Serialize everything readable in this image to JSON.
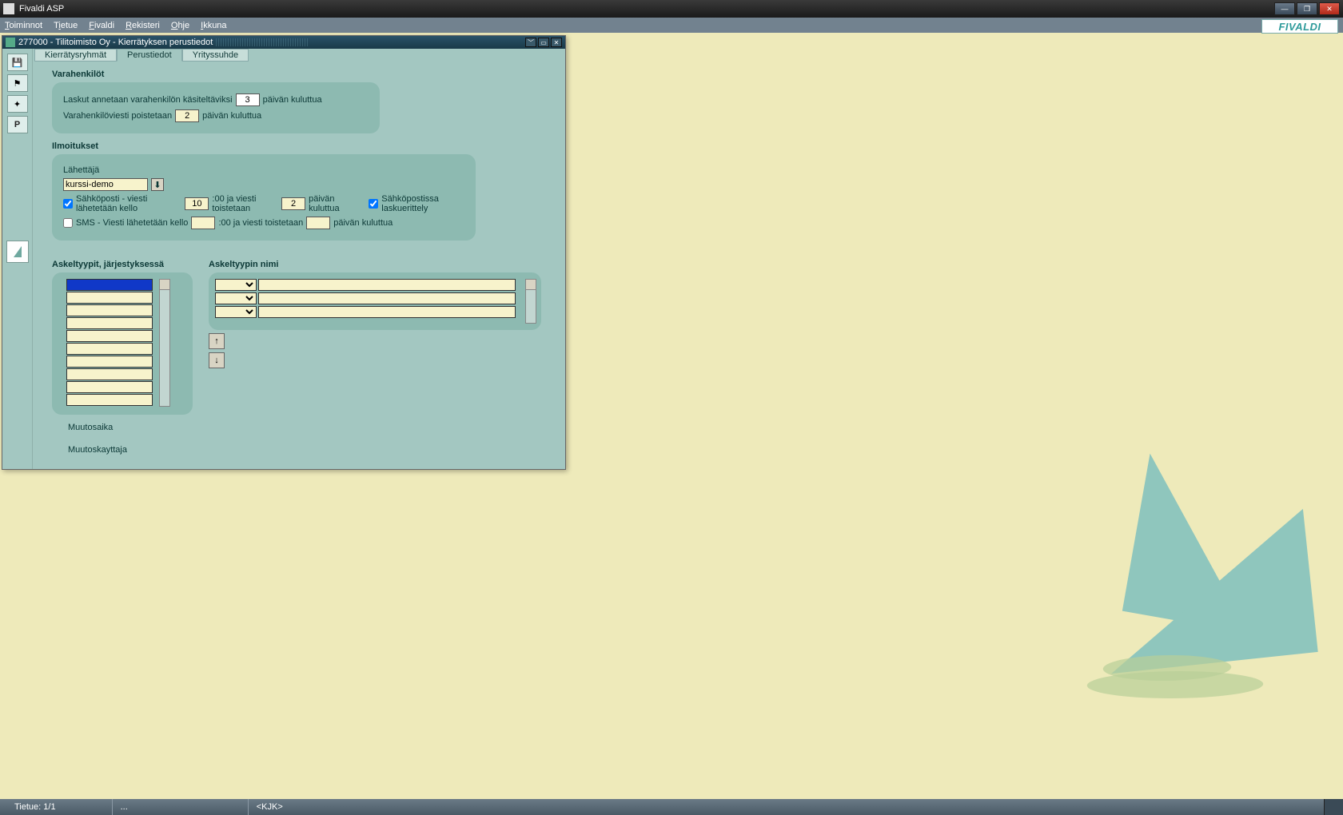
{
  "app": {
    "title": "Fivaldi ASP",
    "brand": "FIVALDI"
  },
  "menu": [
    "Toiminnot",
    "Tietue",
    "Fivaldi",
    "Rekisteri",
    "Ohje",
    "Ikkuna"
  ],
  "window": {
    "title": "277000 - Tilitoimisto Oy - Kierrätyksen perustiedot",
    "tabs": {
      "t1": "Kierrätysryhmät",
      "t2": "Perustiedot",
      "t3": "Yrityssuhde",
      "active": "t2"
    },
    "vara": {
      "heading": "Varahenkilöt",
      "l1a": "Laskut annetaan varahenkilön käsiteltäviksi",
      "v1": "3",
      "l1b": "päivän kuluttua",
      "l2a": "Varahenkilöviesti poistetaan",
      "v2": "2",
      "l2b": "päivän kuluttua"
    },
    "ilmo": {
      "heading": "Ilmoitukset",
      "sender_label": "Lähettäjä",
      "sender": "kurssi-demo",
      "email_label": "Sähköposti - viesti lähetetään kello",
      "email_checked": true,
      "email_h": "10",
      "after_h": ":00 ja viesti toistetaan",
      "email_d": "2",
      "after_d": "päivän kuluttua",
      "erit_label": "Sähköpostissa laskuerittely",
      "erit_checked": true,
      "sms_label": "SMS - Viesti lähetetään kello",
      "sms_checked": false,
      "sms_h": "",
      "sms_d": ""
    },
    "askel": {
      "h1": "Askeltyypit, järjestyksessä",
      "h2": "Askeltyypin nimi",
      "muutosaika": "Muutosaika",
      "muutoskayttaja": "Muutoskayttaja"
    }
  },
  "toolbar": {
    "save": "save",
    "flag": "flag",
    "plus": "plus",
    "p": "P"
  },
  "status": {
    "record": "Tietue: 1/1",
    "dots": "...",
    "user": "<KJK>"
  }
}
